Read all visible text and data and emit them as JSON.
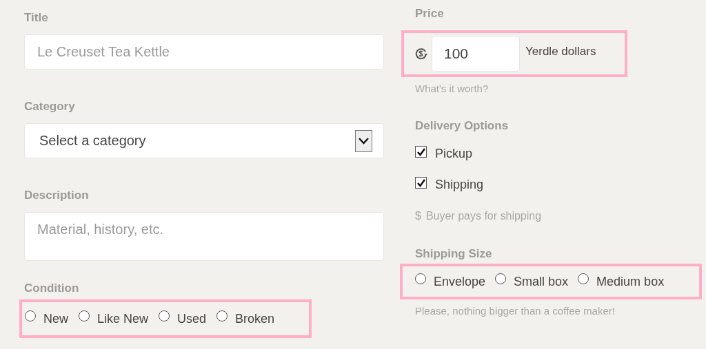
{
  "left": {
    "title": {
      "label": "Title",
      "placeholder": "Le Creuset Tea Kettle"
    },
    "category": {
      "label": "Category",
      "value": "Select a category"
    },
    "description": {
      "label": "Description",
      "placeholder": "Material, history, etc."
    },
    "condition": {
      "label": "Condition",
      "highlighted": true,
      "options": [
        {
          "label": "New",
          "selected": false
        },
        {
          "label": "Like New",
          "selected": false
        },
        {
          "label": "Used",
          "selected": false
        },
        {
          "label": "Broken",
          "selected": false
        }
      ]
    }
  },
  "right": {
    "price": {
      "label": "Price",
      "highlighted": true,
      "value": "100",
      "unit": "Yerdle dollars",
      "hint": "What's it worth?"
    },
    "delivery": {
      "label": "Delivery Options",
      "options": [
        {
          "label": "Pickup",
          "checked": true
        },
        {
          "label": "Shipping",
          "checked": true
        }
      ],
      "note": {
        "symbol": "$",
        "text": "Buyer pays for shipping"
      }
    },
    "shipping_size": {
      "label": "Shipping Size",
      "highlighted": true,
      "options": [
        {
          "label": "Envelope",
          "selected": false
        },
        {
          "label": "Small box",
          "selected": false
        },
        {
          "label": "Medium box",
          "selected": false
        }
      ],
      "hint": "Please, nothing bigger than a coffee maker!"
    }
  }
}
